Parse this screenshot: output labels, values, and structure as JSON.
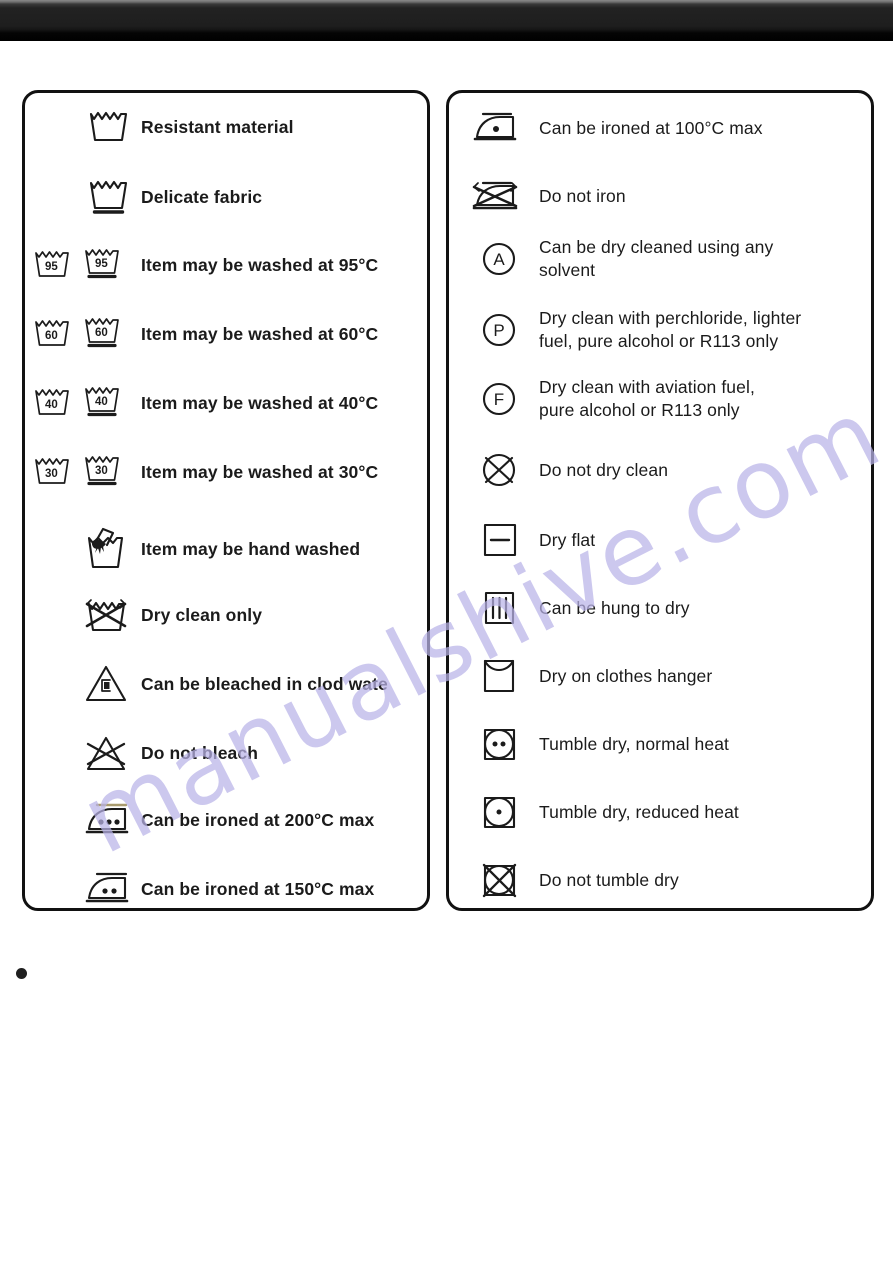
{
  "page": {
    "background_color": "#ffffff",
    "topbar_color": "#000000",
    "text_color": "#1b1b1b",
    "watermark": {
      "text": "manualshive.com",
      "color": "#b9b3e8"
    }
  },
  "left_panel": {
    "items": [
      {
        "icon": "wash-tub-resistant-icon",
        "label": "Resistant material"
      },
      {
        "icon": "wash-tub-delicate-icon",
        "label": "Delicate fabric"
      },
      {
        "icon": "wash-tub-95-icon",
        "label": "Item may be washed at 95°C"
      },
      {
        "icon": "wash-tub-60-icon",
        "label": "Item may be washed at 60°C"
      },
      {
        "icon": "wash-tub-40-icon",
        "label": "Item may be washed at 40°C"
      },
      {
        "icon": "wash-tub-30-icon",
        "label": "Item may be washed at 30°C"
      },
      {
        "icon": "hand-wash-icon",
        "label": "Item may be hand washed"
      },
      {
        "icon": "do-not-wash-dry-clean-only-icon",
        "label": "Dry clean only"
      },
      {
        "icon": "bleach-triangle-cl-icon",
        "label": "Can be bleached in clod wate"
      },
      {
        "icon": "do-not-bleach-icon",
        "label": "Do not bleach"
      },
      {
        "icon": "iron-three-dots-icon",
        "label": "Can be ironed at 200°C max"
      },
      {
        "icon": "iron-two-dots-icon",
        "label": "Can be ironed at 150°C max"
      }
    ]
  },
  "right_panel": {
    "items": [
      {
        "icon": "iron-one-dot-icon",
        "label": "Can be ironed at 100°C max"
      },
      {
        "icon": "do-not-iron-icon",
        "label": "Do not iron"
      },
      {
        "icon": "dry-clean-a-icon",
        "label": "Can be dry cleaned using any\nsolvent"
      },
      {
        "icon": "dry-clean-p-icon",
        "label": "Dry clean with perchloride, lighter\nfuel, pure alcohol or R113 only"
      },
      {
        "icon": "dry-clean-f-icon",
        "label": "Dry clean with aviation fuel,\npure alcohol or R113 only"
      },
      {
        "icon": "do-not-dry-clean-icon",
        "label": "Do not dry clean"
      },
      {
        "icon": "dry-flat-icon",
        "label": "Dry flat"
      },
      {
        "icon": "hang-to-dry-icon",
        "label": "Can be hung to dry"
      },
      {
        "icon": "drip-dry-hanger-icon",
        "label": "Dry on clothes hanger"
      },
      {
        "icon": "tumble-dry-normal-icon",
        "label": "Tumble dry, normal heat"
      },
      {
        "icon": "tumble-dry-reduced-icon",
        "label": "Tumble dry, reduced heat"
      },
      {
        "icon": "do-not-tumble-dry-icon",
        "label": "Do not tumble dry"
      }
    ]
  },
  "footer": {
    "bullet_text": ""
  }
}
